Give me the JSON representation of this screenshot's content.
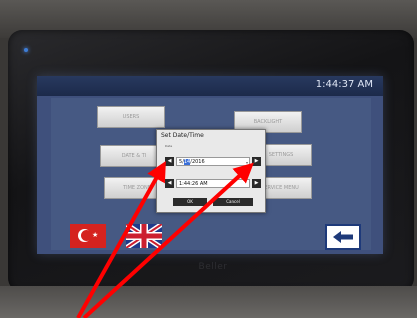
{
  "screen": {
    "clock": "1:44:37 AM",
    "menu": [
      {
        "label": "USERS"
      },
      {
        "label": "BACKLIGHT"
      },
      {
        "label": "DATE & TI"
      },
      {
        "label": "SETTINGS"
      },
      {
        "label": "TIME ZONE"
      },
      {
        "label": "SERVICE MENU"
      }
    ],
    "languages": [
      {
        "icon": "turkey-flag-icon"
      },
      {
        "icon": "uk-flag-icon"
      }
    ],
    "back_icon": "left-arrow-icon"
  },
  "dialog": {
    "title": "Set Date/Time",
    "date_label": "Date",
    "date_month": "5",
    "date_day": "14",
    "date_year": "2016",
    "time_value": "1:44:26 AM",
    "ok_label": "OK",
    "cancel_label": "Cancel"
  },
  "device": {
    "brand": "Beller"
  },
  "colors": {
    "screen_bg": "#3f507c",
    "titlebar": "#1c2a4a",
    "annotation_arrow": "#ff0000",
    "turkey_red": "#d5231f",
    "back_border": "#1e3a7a"
  }
}
